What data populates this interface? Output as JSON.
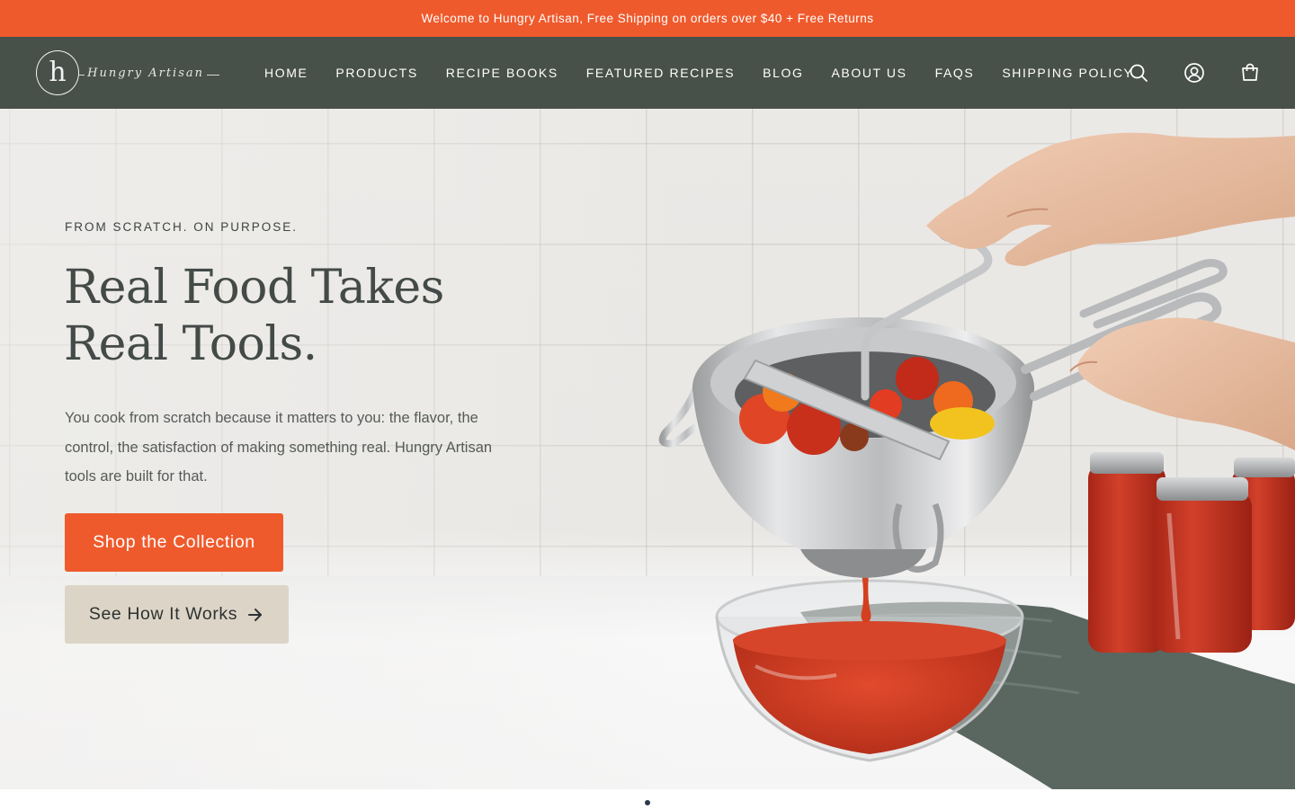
{
  "announcement": {
    "text": "Welcome to Hungry Artisan, Free Shipping on orders over $40 + Free Returns"
  },
  "header": {
    "logo_mark": "h",
    "logo_script": "Hungry Artisan",
    "nav": [
      {
        "label": "HOME"
      },
      {
        "label": "PRODUCTS"
      },
      {
        "label": "RECIPE BOOKS"
      },
      {
        "label": "FEATURED RECIPES"
      },
      {
        "label": "BLOG"
      },
      {
        "label": "ABOUT US"
      },
      {
        "label": "FAQS"
      },
      {
        "label": "SHIPPING POLICY"
      }
    ],
    "icons": [
      "search-icon",
      "account-icon",
      "cart-icon"
    ]
  },
  "hero": {
    "eyebrow": "FROM SCRATCH. ON PURPOSE.",
    "headline_line1": "Real Food Takes",
    "headline_line2": "Real Tools.",
    "body": "You cook from scratch because it matters to you: the flavor, the control, the satisfaction of making something real. Hungry Artisan tools are built for that.",
    "primary_cta": "Shop the Collection",
    "secondary_cta": "See How It Works",
    "secondary_cta_icon": "arrow-right-icon",
    "image_subject": "food-mill-with-tomatoes-and-sauce"
  },
  "slider": {
    "total": 1,
    "active": 1
  },
  "colors": {
    "announcement_bg": "#ef5a2c",
    "header_bg": "#475049",
    "primary_button": "#ef5a2c",
    "secondary_button": "#dcd5c7"
  }
}
